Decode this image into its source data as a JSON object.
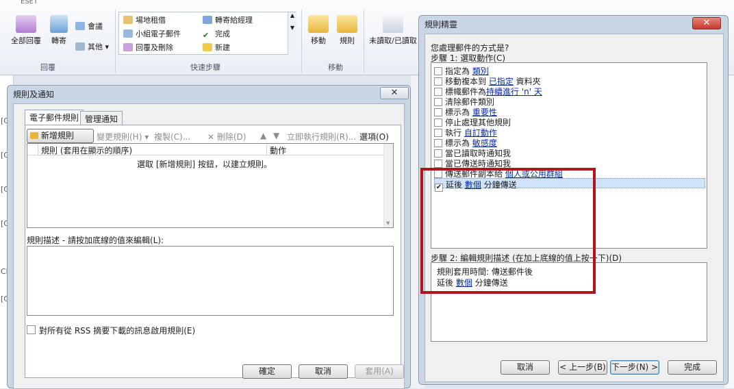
{
  "ribbon": {
    "top_fragment": "ESET",
    "reply_all": "全部回覆",
    "forward": "轉寄",
    "meeting": "會議",
    "more": "其他",
    "group_respond": "回覆",
    "quicksteps": [
      "場地租借",
      "轉寄給經理",
      "小組電子郵件",
      "完成",
      "回覆及刪除",
      "新建"
    ],
    "group_quicksteps": "快速步驟",
    "move": "移動",
    "rules": "規則",
    "group_move": "移動",
    "unread_read": "未讀取/已讀取"
  },
  "rules_dialog": {
    "title": "規則及通知",
    "close": "✕",
    "tabs": [
      "電子郵件規則",
      "管理通知"
    ],
    "toolbar": {
      "new_rule": "新增規則(N)...",
      "change_rule": "變更規則(H) ▾",
      "copy": "複製(C)...",
      "delete": "刪除(D)",
      "run_rules": "立即執行規則(R)...",
      "options": "選項(O)"
    },
    "columns": [
      "規則 (套用在顯示的順序)",
      "動作"
    ],
    "empty_message": "選取 [新增規則] 按鈕，以建立規則。",
    "description_label": "規則描述 - 請按加底線的值來編輯(L):",
    "rss_checkbox": "對所有從 RSS 摘要下載的訊息啟用規則(E)",
    "buttons": {
      "ok": "確定",
      "cancel": "取消",
      "apply": "套用(A)"
    }
  },
  "wizard": {
    "title": "規則精靈",
    "close": "✕",
    "question": "您處理郵件的方式是?",
    "step1": "步驟 1: 選取動作(C)",
    "conditions": [
      {
        "parts": [
          {
            "t": "指定為 "
          },
          {
            "t": "類別",
            "link": true
          }
        ],
        "checked": false
      },
      {
        "parts": [
          {
            "t": "移動複本到 "
          },
          {
            "t": "已指定",
            "link": true
          },
          {
            "t": " 資料夾"
          }
        ],
        "checked": false
      },
      {
        "parts": [
          {
            "t": "標幟郵件為"
          },
          {
            "t": "持續進行 'n' 天",
            "link": true
          }
        ],
        "checked": false
      },
      {
        "parts": [
          {
            "t": "清除郵件類別"
          }
        ],
        "checked": false
      },
      {
        "parts": [
          {
            "t": "標示為 "
          },
          {
            "t": "重要性",
            "link": true
          }
        ],
        "checked": false
      },
      {
        "parts": [
          {
            "t": "停止處理其他規則"
          }
        ],
        "checked": false
      },
      {
        "parts": [
          {
            "t": "執行 "
          },
          {
            "t": "自訂動作",
            "link": true
          }
        ],
        "checked": false
      },
      {
        "parts": [
          {
            "t": "標示為 "
          },
          {
            "t": "敏感度",
            "link": true
          }
        ],
        "checked": false
      },
      {
        "parts": [
          {
            "t": "當已讀取時通知我"
          }
        ],
        "checked": false
      },
      {
        "parts": [
          {
            "t": "當已傳送時通知我"
          }
        ],
        "checked": false
      },
      {
        "parts": [
          {
            "t": "傳送郵件副本給 "
          },
          {
            "t": "個人或公用群組",
            "link": true
          }
        ],
        "checked": false
      },
      {
        "parts": [
          {
            "t": "延後 "
          },
          {
            "t": "數個",
            "link": true
          },
          {
            "t": " 分鐘傳送"
          }
        ],
        "checked": true,
        "selected": true
      }
    ],
    "step2": "步驟 2: 編輯規則描述 (在加上底線的值上按一下)(D)",
    "description_line1": "規則套用時間: 傳送郵件後",
    "description_line2_pre": "延後 ",
    "description_line2_link": "數個",
    "description_line2_post": " 分鐘傳送",
    "buttons": {
      "cancel": "取消",
      "back": "< 上一步(B)",
      "next": "下一步(N) >",
      "finish": "完成"
    }
  },
  "colors": {
    "highlight_box": "#b3131b",
    "link": "#0a2d9e",
    "close_button": "#c8392f"
  }
}
